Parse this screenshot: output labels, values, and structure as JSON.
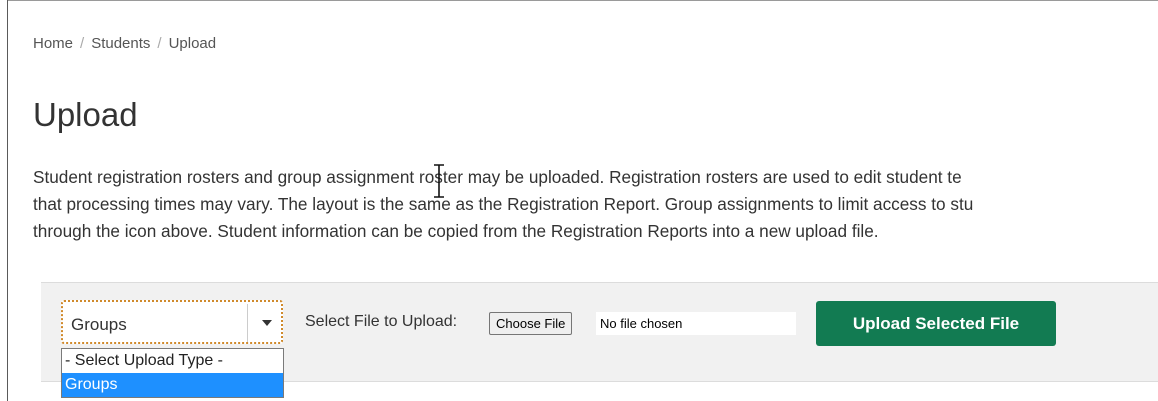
{
  "breadcrumb": {
    "items": [
      "Home",
      "Students",
      "Upload"
    ],
    "separator": "/"
  },
  "page": {
    "title": "Upload",
    "description_lines": [
      "Student registration rosters and group assignment roster may be uploaded. Registration rosters are used to edit student te",
      "that processing times may vary. The layout is the same as the Registration Report. Group assignments to limit access to stu",
      "through the icon above. Student information can be copied from the Registration Reports into a new upload file."
    ]
  },
  "upload": {
    "type_select": {
      "value": "Groups",
      "options": [
        "- Select Upload Type -",
        "Groups"
      ],
      "highlighted": "Groups"
    },
    "file_label": "Select File to Upload:",
    "choose_file_label": "Choose File",
    "file_status": "No file chosen",
    "submit_label": "Upload Selected File",
    "accent_color": "#127b52"
  },
  "cursor": {
    "type": "text-cursor-icon"
  }
}
